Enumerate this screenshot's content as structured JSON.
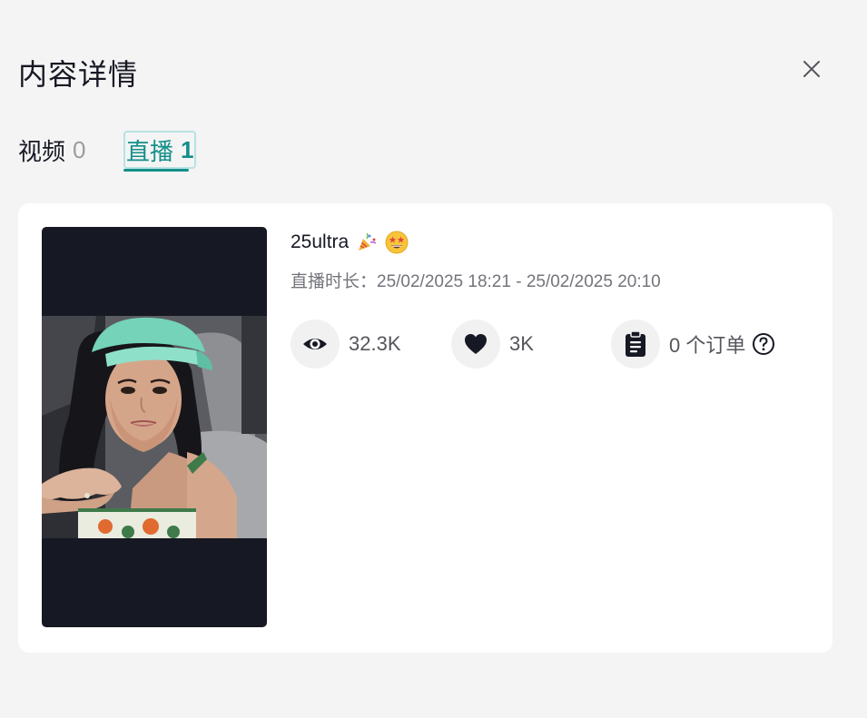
{
  "header": {
    "title": "内容详情",
    "close_icon": "close-icon"
  },
  "tabs": [
    {
      "label": "视频",
      "count": "0",
      "active": false
    },
    {
      "label": "直播",
      "count": "1",
      "active": true
    }
  ],
  "colors": {
    "accent": "#138f8a",
    "background": "#f4f4f4",
    "card": "#ffffff",
    "thumbnail_bg": "#161823"
  },
  "live": {
    "title": "25ultra",
    "title_emojis": [
      "party-popper-icon",
      "star-struck-face-icon"
    ],
    "duration_label": "直播时长：",
    "duration_value": "25/02/2025 18:21 - 25/02/2025 20:10",
    "thumbnail": "woman-in-mint-cap-selfie-image",
    "stats": {
      "views": {
        "icon": "eye-icon",
        "value": "32.3K"
      },
      "likes": {
        "icon": "heart-icon",
        "value": "3K"
      },
      "orders": {
        "icon": "clipboard-icon",
        "value": "0 个订单",
        "help_icon": "question-circle-icon"
      }
    }
  }
}
